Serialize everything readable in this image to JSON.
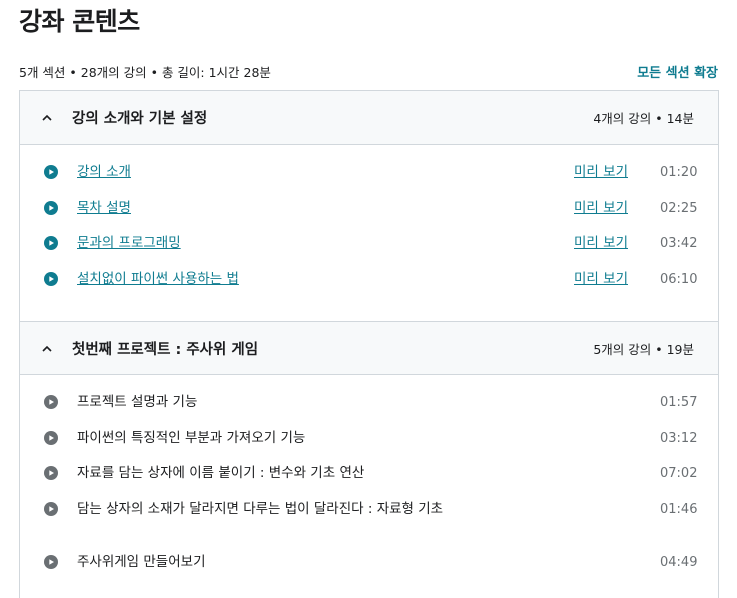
{
  "header": {
    "title": "강좌 콘텐츠"
  },
  "summary": {
    "text": "5개 섹션 • 28개의 강의 • 총 길이: 1시간 28분",
    "expand_all": "모든 섹션 확장"
  },
  "sections": [
    {
      "title": "강의 소개와 기본 설정",
      "meta": "4개의 강의 • 14분",
      "lectures": [
        {
          "title": "강의 소개",
          "preview": "미리 보기",
          "duration": "01:20"
        },
        {
          "title": "목차 설명",
          "preview": "미리 보기",
          "duration": "02:25"
        },
        {
          "title": "문과의 프로그래밍",
          "preview": "미리 보기",
          "duration": "03:42"
        },
        {
          "title": "설치없이 파이썬 사용하는 법",
          "preview": "미리 보기",
          "duration": "06:10"
        }
      ]
    },
    {
      "title": "첫번째 프로젝트 : 주사위 게임",
      "meta": "5개의 강의 • 19분",
      "lectures": [
        {
          "title": "프로젝트 설명과 기능",
          "duration": "01:57"
        },
        {
          "title": "파이썬의 특징적인 부분과 가져오기 기능",
          "duration": "03:12"
        },
        {
          "title": "자료를 담는 상자에 이름 붙이기 : 변수와 기초 연산",
          "duration": "07:02"
        },
        {
          "title": "담는 상자의 소재가 달라지면 다루는 법이 달라진다 : 자료형 기초",
          "duration": "01:46"
        },
        {
          "title": "주사위게임 만들어보기",
          "duration": "04:49"
        }
      ]
    }
  ],
  "colors": {
    "accent": "#0f7c90",
    "play_icon_active": "#0f7c90",
    "play_icon_inactive": "#6a6f73",
    "header_bg": "#f7f9fa",
    "border": "#d1d7dc"
  },
  "icons": {
    "collapse": "chevron-up-icon",
    "lecture": "play-circle-icon"
  }
}
